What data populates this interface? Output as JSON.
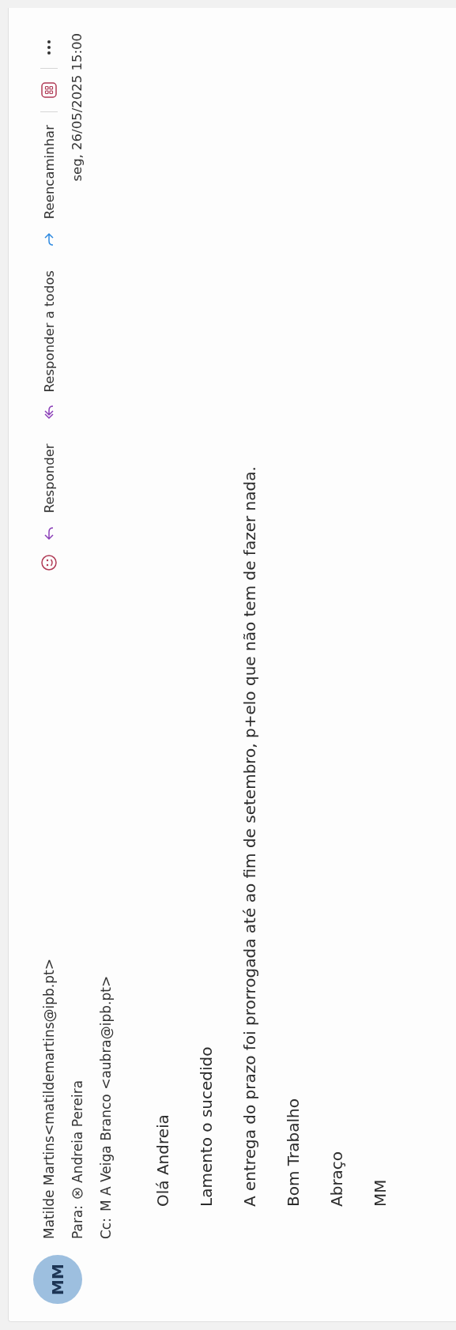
{
  "sender": {
    "initials": "MM",
    "name": "Matilde Martins<matildemartins@ipb.pt>"
  },
  "to": {
    "label": "Para:",
    "recipient": "Andreia Pereira"
  },
  "cc": {
    "label": "Cc:",
    "recipient": "M A Veiga Branco <aubra@ipb.pt>"
  },
  "actions": [
    {
      "kind": "reply",
      "label": "Responder"
    },
    {
      "kind": "reply-all",
      "label": "Responder a todos"
    },
    {
      "kind": "forward",
      "label": "Reencaminhar"
    }
  ],
  "date": "seg, 26/05/2025 15:00",
  "body": [
    "Olá Andreia",
    "Lamento o sucedido",
    "A entrega do prazo foi prorrogada até ao fim de setembro, p+elo que não tem de fazer nada.",
    "Bom Trabalho",
    "Abraço",
    "MM"
  ]
}
